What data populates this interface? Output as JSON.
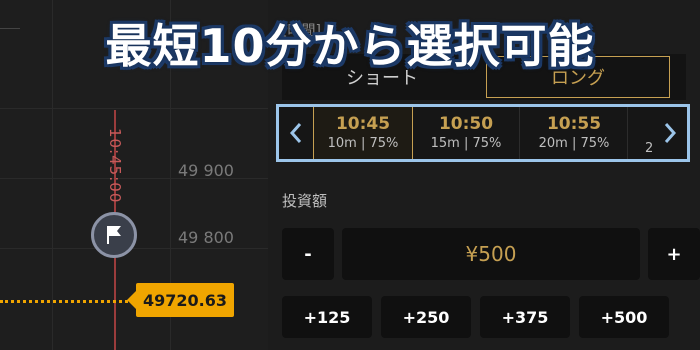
{
  "banner": {
    "text": "最短10分から選択可能"
  },
  "chart": {
    "expiry_label": "10:45:00",
    "price_ticks": [
      "49 900",
      "49 800"
    ],
    "current_price": "49720.63",
    "flag_icon": "flag-icon",
    "colors": {
      "price": "#f0a500",
      "expiry": "#9b3c3c"
    }
  },
  "panel": {
    "time_label": "[時間]",
    "direction": {
      "short": "ショート",
      "long": "ロング"
    },
    "slots": [
      {
        "time": "10:45",
        "sub": "10m | 75%"
      },
      {
        "time": "10:50",
        "sub": "15m | 75%"
      },
      {
        "time": "10:55",
        "sub": "20m | 75%"
      }
    ],
    "slot_partial": "2",
    "invest_label": "投資額",
    "amount": "¥500",
    "minus": "-",
    "plus": "+",
    "quick_add": [
      "+125",
      "+250",
      "+375",
      "+500"
    ],
    "colors": {
      "accent": "#c6a052",
      "highlight": "#9cc5ea"
    }
  }
}
